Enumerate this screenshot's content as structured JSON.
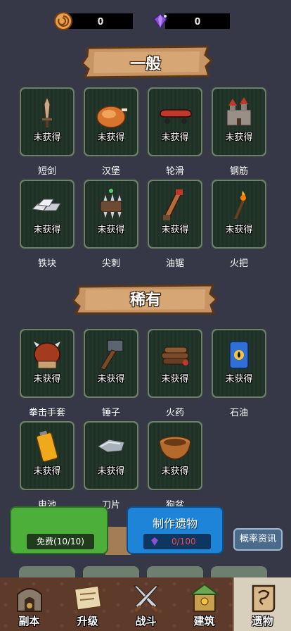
{
  "currency": [
    {
      "icon": "swirl-token-icon",
      "value": "0"
    },
    {
      "icon": "purple-gem-icon",
      "value": "0"
    }
  ],
  "sections": {
    "common": {
      "title": "一般"
    },
    "rare": {
      "title": "稀有"
    }
  },
  "status_text": "未获得",
  "items": {
    "common": [
      {
        "name": "短剑",
        "icon": "dagger-icon"
      },
      {
        "name": "汉堡",
        "icon": "roast-chicken-icon"
      },
      {
        "name": "轮滑",
        "icon": "skateboard-icon"
      },
      {
        "name": "钢筋",
        "icon": "castle-icon"
      },
      {
        "name": "铁块",
        "icon": "iron-ingots-icon"
      },
      {
        "name": "尖刺",
        "icon": "spike-ball-icon"
      },
      {
        "name": "油锯",
        "icon": "chainsaw-icon"
      },
      {
        "name": "火把",
        "icon": "torch-icon"
      }
    ],
    "rare": [
      {
        "name": "拳击手套",
        "icon": "spiked-glove-icon"
      },
      {
        "name": "锤子",
        "icon": "hammer-icon"
      },
      {
        "name": "火药",
        "icon": "powder-logs-icon"
      },
      {
        "name": "石油",
        "icon": "oil-barrel-icon"
      },
      {
        "name": "电池",
        "icon": "battery-icon"
      },
      {
        "name": "刀片",
        "icon": "blade-icon"
      },
      {
        "name": "狗盆",
        "icon": "dog-bowl-icon"
      }
    ]
  },
  "actions": {
    "free": {
      "label": "免费(10/10)"
    },
    "craft": {
      "label": "制作遗物",
      "cost": "0/100"
    },
    "probability": {
      "label": "概率资讯"
    }
  },
  "nav": [
    {
      "label": "副本",
      "icon": "dungeon-icon",
      "active": false
    },
    {
      "label": "升级",
      "icon": "upgrade-map-icon",
      "active": false
    },
    {
      "label": "战斗",
      "icon": "crossed-swords-icon",
      "active": false
    },
    {
      "label": "建筑",
      "icon": "building-icon",
      "active": false
    },
    {
      "label": "遗物",
      "icon": "relic-scroll-icon",
      "active": true
    }
  ],
  "colors": {
    "background": "#363847",
    "card_border": "#6e7f70",
    "free_button": "#4caf3a",
    "craft_button": "#1d84d8",
    "craft_cost": "#ff4444",
    "nav_bg": "#5e3a2a"
  }
}
